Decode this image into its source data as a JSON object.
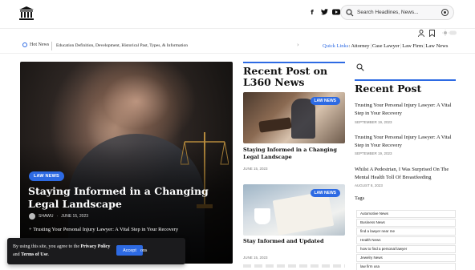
{
  "header": {
    "search_placeholder": "Search Headlines, News..."
  },
  "ticker": {
    "label": "Hot News",
    "headline": "Education Definition, Development, Historical Past, Types, & Information",
    "quick_links_label": "Quick Links",
    "quick_links": [
      "Attorney",
      "Case Lawyer",
      "Law Firm",
      "Law News"
    ]
  },
  "hero": {
    "tag": "LAW NEWS",
    "title": "Staying Informed in a Changing Legal Landscape",
    "author": "SHAWU",
    "date": "JUNE 15, 2023",
    "related": "Trusting Your Personal Injury Lawyer: A Vital Step in Your Recovery"
  },
  "cookie": {
    "text_1": "By using this site, you agree to the ",
    "privacy": "Privacy Policy",
    "and": " and ",
    "terms": "Terms of Use",
    "text_end": ".",
    "accept": "Accept",
    "tail": "ons"
  },
  "middle": {
    "heading": "Recent Post on L360 News",
    "cards": [
      {
        "tag": "LAW NEWS",
        "title": "Staying Informed in a Changing Legal Landscape",
        "date": "JUNE 15, 2023"
      },
      {
        "tag": "LAW NEWS",
        "title": "Stay Informed and Updated",
        "date": "JUNE 15, 2023"
      }
    ]
  },
  "sidebar": {
    "heading": "Recent Post",
    "posts": [
      {
        "title": "Trusting Your Personal Injury Lawyer: A Vital Step in Your Recovery",
        "date": "SEPTEMBER 19, 2023"
      },
      {
        "title": "Trusting Your Personal Injury Lawyer: A Vital Step in Your Recovery",
        "date": "SEPTEMBER 19, 2023"
      },
      {
        "title": "Whilst A Pedestrian, I Was Surprised On The Mental Health Toll Of Breastfeeding",
        "date": "AUGUST 8, 2023"
      }
    ],
    "tags_heading": "Tags",
    "tags": [
      "Automotive News",
      "Business News",
      "find a lawyer near me",
      "Health News",
      "how to find a personal lawyer",
      "Jewelry News",
      "law firm usa"
    ]
  },
  "colors": {
    "accent": "#2d6ae3"
  }
}
